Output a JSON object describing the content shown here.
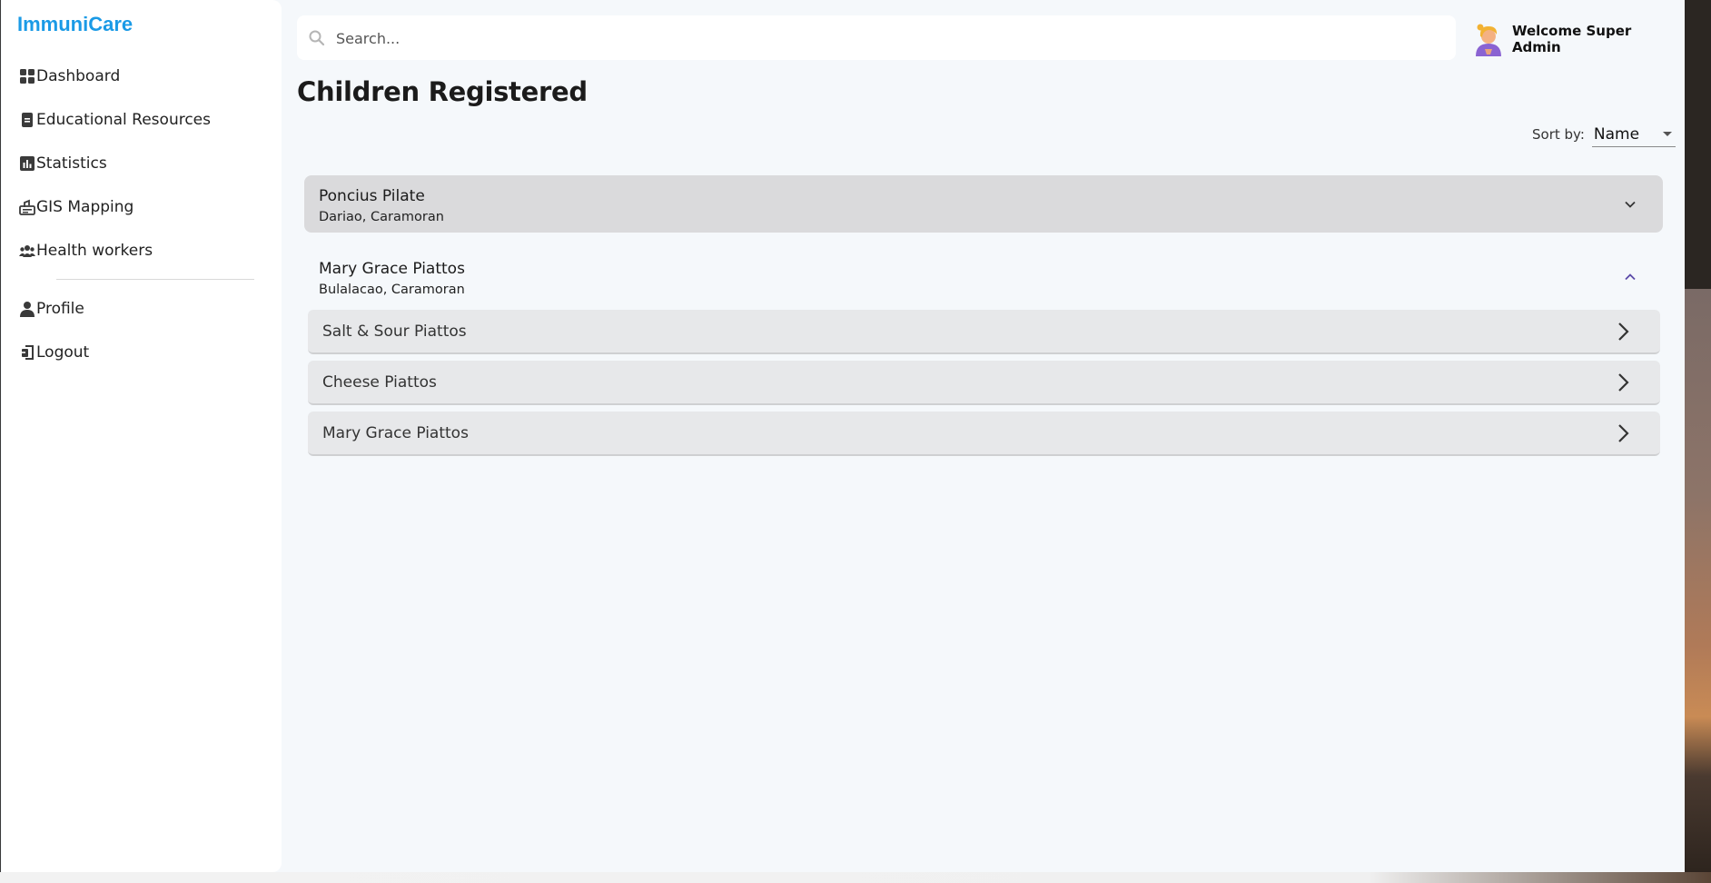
{
  "app": {
    "brand": "ImmuniCare"
  },
  "sidebar": {
    "items": [
      {
        "label": "Dashboard",
        "icon": "dashboard-icon"
      },
      {
        "label": "Educational Resources",
        "icon": "book-icon"
      },
      {
        "label": "Statistics",
        "icon": "chart-icon"
      },
      {
        "label": "GIS Mapping",
        "icon": "map-icon"
      },
      {
        "label": "Health workers",
        "icon": "users-icon"
      }
    ],
    "account_items": [
      {
        "label": "Profile",
        "icon": "person-icon"
      },
      {
        "label": "Logout",
        "icon": "logout-icon"
      }
    ]
  },
  "header": {
    "search_placeholder": "Search...",
    "welcome": "Welcome Super Admin"
  },
  "main": {
    "title": "Children Registered",
    "sort_label": "Sort by:",
    "sort_value": "Name",
    "groups": [
      {
        "name": "Poncius Pilate",
        "location": "Dariao, Caramoran",
        "expanded": false
      },
      {
        "name": "Mary Grace Piattos",
        "location": "Bulalacao, Caramoran",
        "expanded": true,
        "children": [
          "Salt & Sour Piattos",
          "Cheese Piattos",
          "Mary Grace Piattos"
        ]
      }
    ]
  },
  "colors": {
    "brand": "#1a9ae6",
    "collapsed_header": "#dadadc",
    "child_row": "#e7e8ea",
    "page_bg": "#f5f8fb"
  }
}
